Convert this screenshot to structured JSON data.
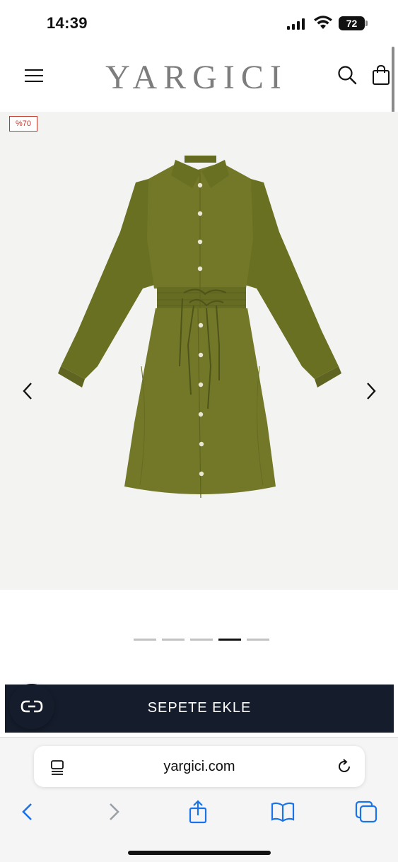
{
  "status_bar": {
    "time": "14:39",
    "battery": "72",
    "icons": [
      "signal-icon",
      "wifi-icon",
      "battery-icon"
    ]
  },
  "header": {
    "logo": "YARGICI",
    "icons": [
      "menu-icon",
      "search-icon",
      "shopping-bag-icon"
    ]
  },
  "product": {
    "discount_badge": "%70",
    "image": "olive-green-shirt-dress",
    "dress_color": "#6e7424",
    "gallery_background": "#f3f3f1",
    "pager": {
      "count": 5,
      "active_index": 4
    }
  },
  "cart": {
    "button_label": "SEPETE EKLE",
    "color": "#151c2b"
  },
  "browser": {
    "url": "yargici.com",
    "toolbar": [
      "back-icon",
      "forward-icon",
      "share-icon",
      "bookmarks-icon",
      "tabs-icon"
    ],
    "accent": "#1a73e8"
  }
}
